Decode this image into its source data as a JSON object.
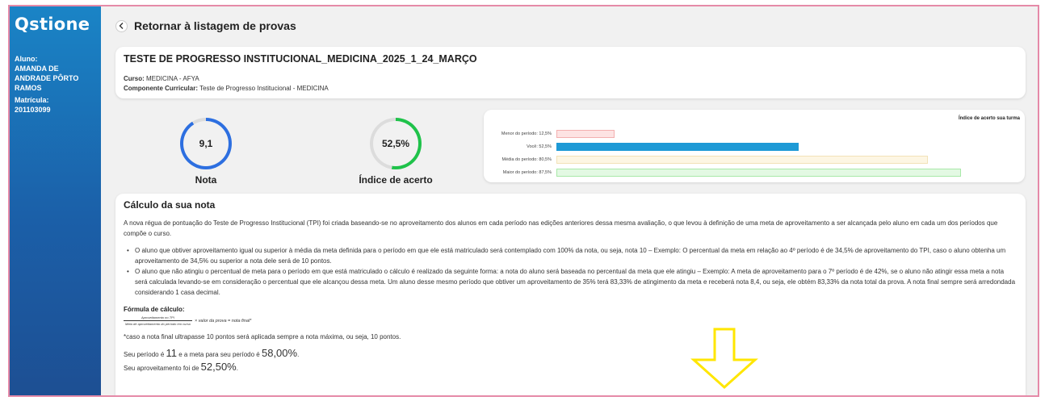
{
  "sidebar": {
    "logo": "Qstione",
    "student_label": "Aluno:",
    "student_name": "AMANDA DE ANDRADE PÔRTO RAMOS",
    "registration_label": "Matrícula:",
    "registration_value": "201103099"
  },
  "header": {
    "back_icon": "chevron-left-icon",
    "back_label": "Retornar à listagem de provas"
  },
  "exam": {
    "title": "TESTE DE PROGRESSO INSTITUCIONAL_MEDICINA_2025_1_24_MARÇO",
    "course_label": "Curso:",
    "course_value": "MEDICINA - AFYA",
    "component_label": "Componente Curricular:",
    "component_value": "Teste de Progresso Institucional - MEDICINA"
  },
  "stats": {
    "grade_value": "9,1",
    "grade_label": "Nota",
    "grade_fraction": 0.91,
    "accuracy_value": "52,5%",
    "accuracy_label": "Índice de acerto",
    "accuracy_fraction": 0.525,
    "grade_color": "#2d6fe0",
    "accuracy_color": "#1fc24a"
  },
  "chart_data": {
    "type": "bar",
    "orientation": "horizontal",
    "title": "Índice de acerto sua turma",
    "categories": [
      "Menor do período: 12,5%",
      "Você: 52,5%",
      "Média do período: 80,5%",
      "Maior do período: 87,5%"
    ],
    "values": [
      12.5,
      52.5,
      80.5,
      87.5
    ],
    "colors": [
      "#fde3e3",
      "#1e9ad6",
      "#fdf6e3",
      "#e3f9e3"
    ],
    "borders": [
      "#f3b0b0",
      "#1e9ad6",
      "#f2e2b8",
      "#a8e8a8"
    ],
    "xlim": [
      0,
      100
    ],
    "grid": false
  },
  "calculation": {
    "title": "Cálculo da sua nota",
    "intro": "A nova régua de pontuação do Teste de Progresso Institucional (TPI) foi criada baseando-se no aproveitamento dos alunos em cada período nas edições anteriores dessa mesma avaliação, o que levou à definição de uma meta de aproveitamento a ser alcançada pelo aluno em cada um dos períodos que compõe o curso.",
    "rules": [
      "O aluno que obtiver aproveitamento igual ou superior à média da meta definida para o período em que ele está matriculado será contemplado com 100% da nota, ou seja, nota 10 – Exemplo: O percentual da meta em relação ao 4º período é de 34,5% de aproveitamento do TPI, caso o aluno obtenha um aproveitamento de 34,5% ou superior a nota dele será de 10 pontos.",
      "O aluno que não atingiu o percentual de meta para o período em que está matriculado o cálculo é realizado da seguinte forma: a nota do aluno será baseada no percentual da meta que ele atingiu – Exemplo: A meta de aproveitamento para o 7º período é de 42%, se o aluno não atingir essa meta a nota será calculada levando-se em consideração o percentual que ele alcançou dessa meta. Um aluno desse mesmo período que obtiver um aproveitamento de 35% terá 83,33% de atingimento da meta e receberá nota 8,4, ou seja, ele obtém 83,33% da nota total da prova. A nota final sempre será arredondada considerando 1 casa decimal."
    ],
    "formula_label": "Fórmula de cálculo:",
    "formula_numerator": "Aproveitamento no TPI",
    "formula_denominator": "Meta de aproveitamento do período em curso",
    "formula_rest": "× valor da prova = nota final*",
    "note": "*caso a nota final ultrapasse 10 pontos será aplicada sempre a nota máxima, ou seja, 10 pontos.",
    "period_prefix": "Seu período é",
    "period_value": "11",
    "goal_prefix": "e a meta para seu período é",
    "goal_value": "58,00%",
    "result_suffix": ".",
    "performance_prefix": "Seu aproveitamento foi de",
    "performance_value": "52,50%"
  },
  "overlay": {
    "arrow_icon": "arrow-down-outline-icon",
    "arrow_color": "#ffe600"
  }
}
